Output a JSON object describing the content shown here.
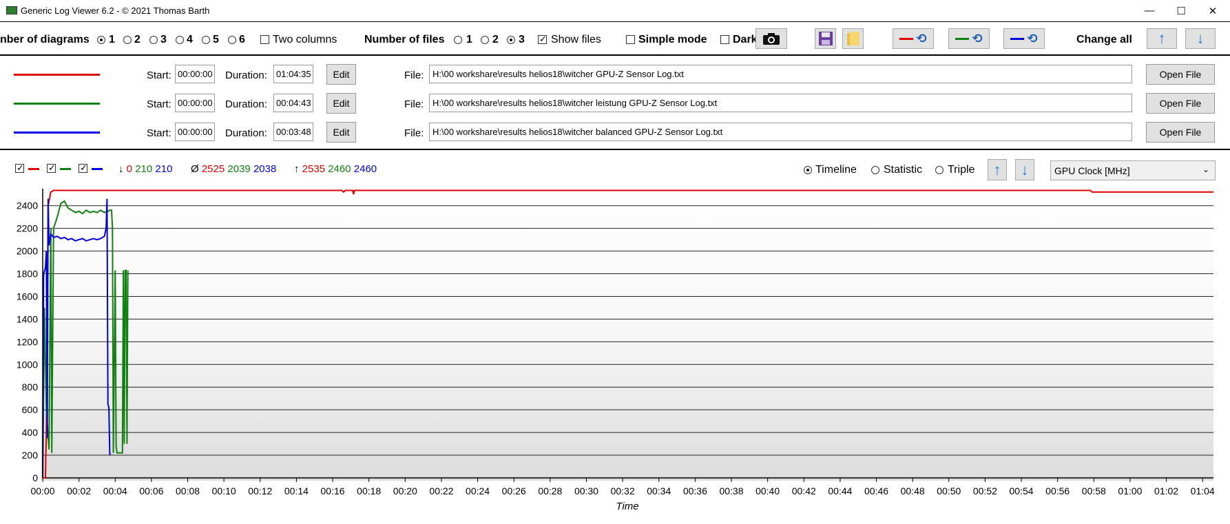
{
  "window": {
    "title": "Generic Log Viewer 6.2 - © 2021 Thomas Barth"
  },
  "toolbar": {
    "num_diagrams_label": "nber of diagrams",
    "diagram_options": [
      "1",
      "2",
      "3",
      "4",
      "5",
      "6"
    ],
    "diagram_selected": "1",
    "two_columns_label": "Two columns",
    "num_files_label": "Number of files",
    "file_options": [
      "1",
      "2",
      "3"
    ],
    "files_selected": "3",
    "show_files_label": "Show files",
    "show_files_checked": true,
    "simple_mode_label": "Simple mode",
    "dark_label": "Dark",
    "change_all_label": "Change all"
  },
  "colors": {
    "red": "#e00000",
    "green": "#108010",
    "blue": "#0000e0",
    "accent": "#1f7ad6"
  },
  "files": [
    {
      "color": "#e00000",
      "start_label": "Start:",
      "start": "00:00:00",
      "duration_label": "Duration:",
      "duration": "01:04:35",
      "edit_label": "Edit",
      "file_label": "File:",
      "path": "H:\\00 workshare\\results helios18\\witcher GPU-Z Sensor Log.txt",
      "open_label": "Open File"
    },
    {
      "color": "#108010",
      "start_label": "Start:",
      "start": "00:00:00",
      "duration_label": "Duration:",
      "duration": "00:04:43",
      "edit_label": "Edit",
      "file_label": "File:",
      "path": "H:\\00 workshare\\results helios18\\witcher leistung GPU-Z Sensor Log.txt",
      "open_label": "Open File"
    },
    {
      "color": "#0000e0",
      "start_label": "Start:",
      "start": "00:00:00",
      "duration_label": "Duration:",
      "duration": "00:03:48",
      "edit_label": "Edit",
      "file_label": "File:",
      "path": "H:\\00 workshare\\results helios18\\witcher balanced GPU-Z Sensor Log.txt",
      "open_label": "Open File"
    }
  ],
  "chart_header": {
    "min_symbol": "↓",
    "min_values": [
      "0",
      "210",
      "210"
    ],
    "avg_symbol": "Ø",
    "avg_values": [
      "2525",
      "2039",
      "2038"
    ],
    "max_symbol": "↑",
    "max_values": [
      "2535",
      "2460",
      "2460"
    ],
    "view_options": [
      "Timeline",
      "Statistic",
      "Triple"
    ],
    "view_selected": "Timeline",
    "sensor_selected": "GPU Clock [MHz]"
  },
  "chart_data": {
    "type": "line",
    "xlabel": "Time",
    "ylabel": "",
    "ylim": [
      0,
      2550
    ],
    "xlim_minutes": [
      0,
      64.6
    ],
    "y_ticks": [
      0,
      200,
      400,
      600,
      800,
      1000,
      1200,
      1400,
      1600,
      1800,
      2000,
      2200,
      2400
    ],
    "x_tick_labels": [
      "00:00",
      "00:02",
      "00:04",
      "00:06",
      "00:08",
      "00:10",
      "00:12",
      "00:14",
      "00:16",
      "00:18",
      "00:20",
      "00:22",
      "00:24",
      "00:26",
      "00:28",
      "00:30",
      "00:32",
      "00:34",
      "00:36",
      "00:38",
      "00:40",
      "00:42",
      "00:44",
      "00:46",
      "00:48",
      "00:50",
      "00:52",
      "00:54",
      "00:56",
      "00:58",
      "01:00",
      "01:02",
      "01:04"
    ],
    "grid": true,
    "series": [
      {
        "color": "#e00000",
        "points": [
          [
            0,
            0
          ],
          [
            0.15,
            0
          ],
          [
            0.2,
            400
          ],
          [
            0.3,
            2400
          ],
          [
            0.45,
            2520
          ],
          [
            0.6,
            2535
          ],
          [
            16.5,
            2535
          ],
          [
            16.6,
            2520
          ],
          [
            16.7,
            2535
          ],
          [
            17.1,
            2535
          ],
          [
            17.15,
            2500
          ],
          [
            17.2,
            2535
          ],
          [
            57.8,
            2535
          ],
          [
            57.9,
            2520
          ],
          [
            64.6,
            2520
          ]
        ]
      },
      {
        "color": "#108010",
        "points": [
          [
            0,
            0
          ],
          [
            0.1,
            1500
          ],
          [
            0.2,
            600
          ],
          [
            0.35,
            250
          ],
          [
            0.45,
            2200
          ],
          [
            0.5,
            220
          ],
          [
            0.6,
            2200
          ],
          [
            0.8,
            2300
          ],
          [
            1.0,
            2420
          ],
          [
            1.2,
            2440
          ],
          [
            1.4,
            2380
          ],
          [
            1.6,
            2360
          ],
          [
            1.8,
            2340
          ],
          [
            2.0,
            2350
          ],
          [
            2.2,
            2330
          ],
          [
            2.4,
            2360
          ],
          [
            2.6,
            2340
          ],
          [
            2.8,
            2350
          ],
          [
            3.0,
            2340
          ],
          [
            3.2,
            2360
          ],
          [
            3.4,
            2340
          ],
          [
            3.6,
            2350
          ],
          [
            3.7,
            2360
          ],
          [
            3.8,
            2360
          ],
          [
            3.85,
            2200
          ],
          [
            3.9,
            220
          ],
          [
            4.0,
            1830
          ],
          [
            4.05,
            280
          ],
          [
            4.1,
            220
          ],
          [
            4.3,
            220
          ],
          [
            4.4,
            220
          ],
          [
            4.45,
            1830
          ],
          [
            4.5,
            300
          ],
          [
            4.55,
            1830
          ],
          [
            4.6,
            1830
          ],
          [
            4.65,
            300
          ],
          [
            4.7,
            1830
          ]
        ]
      },
      {
        "color": "#0000e0",
        "points": [
          [
            0,
            0
          ],
          [
            0.05,
            1800
          ],
          [
            0.15,
            1850
          ],
          [
            0.2,
            2000
          ],
          [
            0.25,
            350
          ],
          [
            0.3,
            2460
          ],
          [
            0.35,
            2050
          ],
          [
            0.45,
            2150
          ],
          [
            0.6,
            2120
          ],
          [
            0.8,
            2130
          ],
          [
            1.0,
            2110
          ],
          [
            1.2,
            2120
          ],
          [
            1.4,
            2100
          ],
          [
            1.6,
            2110
          ],
          [
            1.8,
            2090
          ],
          [
            2.0,
            2100
          ],
          [
            2.2,
            2110
          ],
          [
            2.4,
            2090
          ],
          [
            2.6,
            2100
          ],
          [
            2.8,
            2110
          ],
          [
            3.0,
            2100
          ],
          [
            3.2,
            2110
          ],
          [
            3.4,
            2130
          ],
          [
            3.5,
            2200
          ],
          [
            3.55,
            2460
          ],
          [
            3.6,
            650
          ],
          [
            3.65,
            620
          ],
          [
            3.7,
            210
          ],
          [
            3.75,
            210
          ]
        ]
      }
    ]
  }
}
